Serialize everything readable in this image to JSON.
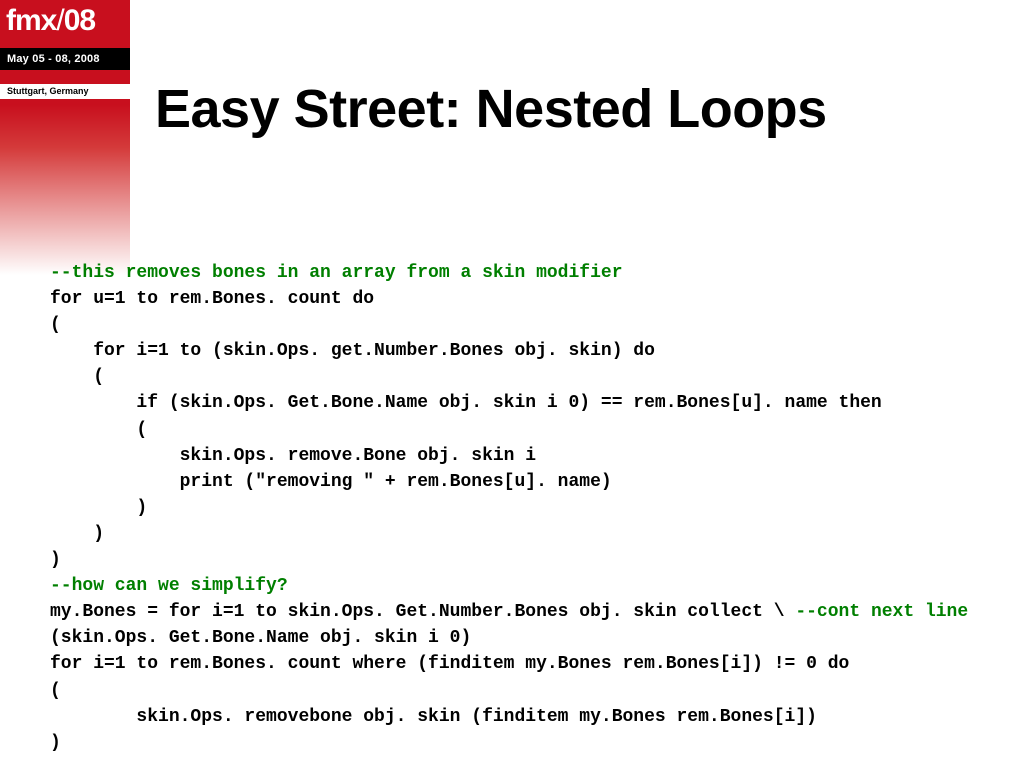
{
  "logo": {
    "brand": "fmx",
    "sep": "/",
    "year": "08"
  },
  "date": "May 05 - 08, 2008",
  "location": "Stuttgart, Germany",
  "title": "Easy Street: Nested Loops",
  "code": {
    "c1": "--this removes bones in an array from a skin modifier",
    "l2": "for u=1 to rem.Bones. count do",
    "l3": "(",
    "l4": "    for i=1 to (skin.Ops. get.Number.Bones obj. skin) do",
    "l5": "    (",
    "l6": "        if (skin.Ops. Get.Bone.Name obj. skin i 0) == rem.Bones[u]. name then",
    "l7": "        (",
    "l8": "            skin.Ops. remove.Bone obj. skin i",
    "l9": "            print (\"removing \" + rem.Bones[u]. name)",
    "l10": "        )",
    "l11": "    )",
    "l12": ")",
    "c2": "--how can we simplify?",
    "l14a": "my.Bones = for i=1 to skin.Ops. Get.Number.Bones obj. skin collect \\ ",
    "c14b": "--cont next line",
    "l15": "(skin.Ops. Get.Bone.Name obj. skin i 0)",
    "l16": "for i=1 to rem.Bones. count where (finditem my.Bones rem.Bones[i]) != 0 do",
    "l17": "(",
    "l18": "        skin.Ops. removebone obj. skin (finditem my.Bones rem.Bones[i])",
    "l19": ")"
  }
}
